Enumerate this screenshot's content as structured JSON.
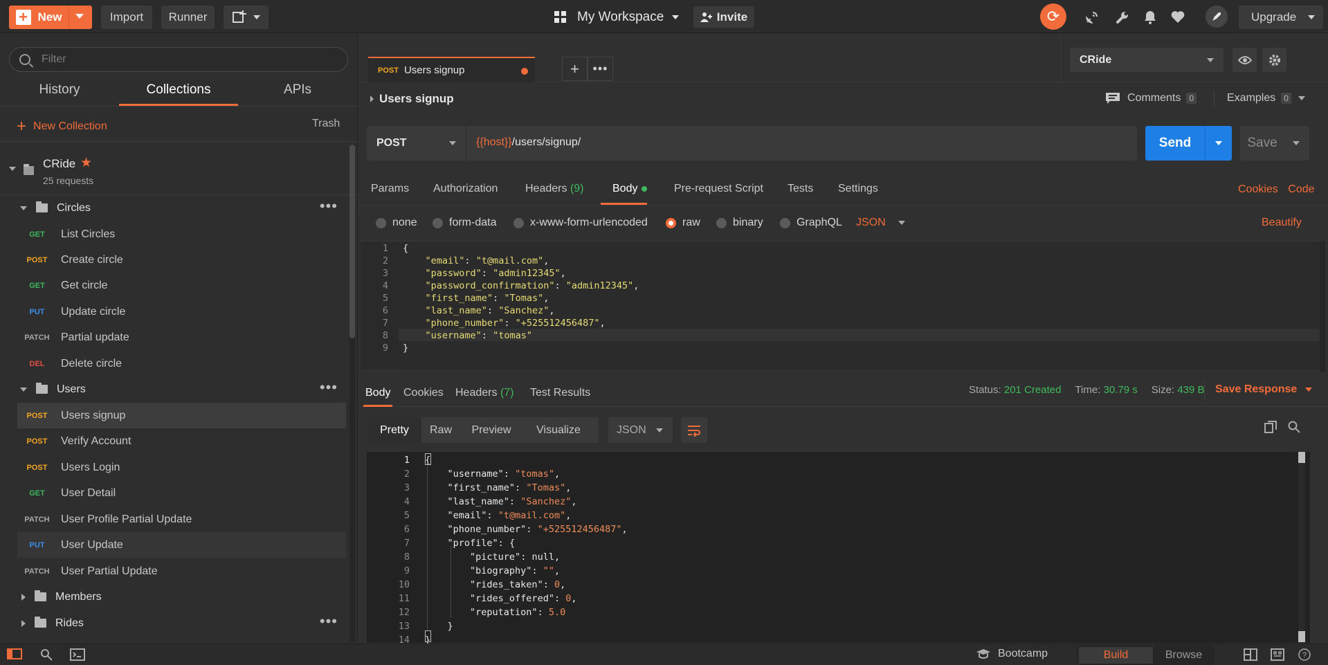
{
  "topbar": {
    "new_label": "New",
    "import_label": "Import",
    "runner_label": "Runner",
    "workspace_label": "My Workspace",
    "invite_label": "Invite",
    "upgrade_label": "Upgrade",
    "icons": [
      "sync-icon",
      "satellite-icon",
      "wrench-icon",
      "bell-icon",
      "heart-icon",
      "rocket-icon"
    ],
    "accent": "#f26b3a"
  },
  "sidebar": {
    "filter_placeholder": "Filter",
    "tabs": [
      "History",
      "Collections",
      "APIs"
    ],
    "active_tab": "Collections",
    "new_collection_label": "New Collection",
    "trash_label": "Trash",
    "collection": {
      "name": "CRide",
      "count": "25 requests"
    },
    "folders": {
      "circles": "Circles",
      "users": "Users",
      "members": "Members",
      "rides": "Rides"
    },
    "circle_items": [
      {
        "method": "GET",
        "name": "List Circles"
      },
      {
        "method": "POST",
        "name": "Create circle"
      },
      {
        "method": "GET",
        "name": "Get circle"
      },
      {
        "method": "PUT",
        "name": "Update circle"
      },
      {
        "method": "PATCH",
        "name": "Partial update"
      },
      {
        "method": "DEL",
        "name": "Delete circle"
      }
    ],
    "user_items": [
      {
        "method": "POST",
        "name": "Users signup"
      },
      {
        "method": "POST",
        "name": "Verify Account"
      },
      {
        "method": "POST",
        "name": "Users Login"
      },
      {
        "method": "GET",
        "name": "User Detail"
      },
      {
        "method": "PATCH",
        "name": "User Profile Partial Update"
      },
      {
        "method": "PUT",
        "name": "User Update"
      },
      {
        "method": "PATCH",
        "name": "User Partial Update"
      }
    ]
  },
  "tab": {
    "method": "POST",
    "title": "Users signup"
  },
  "environment": {
    "selected": "CRide"
  },
  "request": {
    "title": "Users signup",
    "comments_label": "Comments",
    "comments_count": "0",
    "examples_label": "Examples",
    "examples_count": "0",
    "method": "POST",
    "url_var": "{{host}}",
    "url_path": "/users/signup/",
    "send_label": "Send",
    "save_label": "Save",
    "tabs": {
      "params": "Params",
      "authorization": "Authorization",
      "headers": "Headers",
      "headers_count": "(9)",
      "body": "Body",
      "prerequest": "Pre-request Script",
      "tests": "Tests",
      "settings": "Settings"
    },
    "cookies_label": "Cookies",
    "code_label": "Code",
    "body_types": [
      "none",
      "form-data",
      "x-www-form-urlencoded",
      "raw",
      "binary",
      "GraphQL"
    ],
    "selected_body_type": "raw",
    "format": "JSON",
    "beautify_label": "Beautify",
    "body_lines": [
      "{",
      "    \"email\": \"t@mail.com\",",
      "    \"password\": \"admin12345\",",
      "    \"password_confirmation\": \"admin12345\",",
      "    \"first_name\": \"Tomas\",",
      "    \"last_name\": \"Sanchez\",",
      "    \"phone_number\": \"+525512456487\",",
      "    \"username\": \"tomas\"",
      "}"
    ]
  },
  "response": {
    "tabs": {
      "body": "Body",
      "cookies": "Cookies",
      "headers": "Headers",
      "headers_count": "(7)",
      "test_results": "Test Results"
    },
    "status_label": "Status:",
    "status_value": "201 Created",
    "time_label": "Time:",
    "time_value": "30.79 s",
    "size_label": "Size:",
    "size_value": "439 B",
    "save_response_label": "Save Response",
    "views": [
      "Pretty",
      "Raw",
      "Preview",
      "Visualize"
    ],
    "format": "JSON",
    "body_lines": [
      "{",
      "    \"username\": \"tomas\",",
      "    \"first_name\": \"Tomas\",",
      "    \"last_name\": \"Sanchez\",",
      "    \"email\": \"t@mail.com\",",
      "    \"phone_number\": \"+525512456487\",",
      "    \"profile\": {",
      "        \"picture\": null,",
      "        \"biography\": \"\",",
      "        \"rides_taken\": 0,",
      "        \"rides_offered\": 0,",
      "        \"reputation\": 5.0",
      "    }",
      "}"
    ]
  },
  "footer": {
    "bootcamp_label": "Bootcamp",
    "build_label": "Build",
    "browse_label": "Browse"
  }
}
